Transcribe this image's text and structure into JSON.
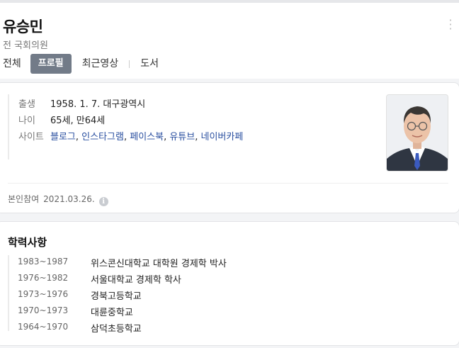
{
  "person": {
    "name": "유승민",
    "subtitle": "전 국회의원"
  },
  "tabs": [
    {
      "label": "전체",
      "active": false
    },
    {
      "label": "프로필",
      "active": true
    },
    {
      "label": "최근영상",
      "active": false
    },
    {
      "label": "도서",
      "active": false
    }
  ],
  "profile": {
    "rows": [
      {
        "label": "출생",
        "value": "1958. 1. 7. 대구광역시"
      },
      {
        "label": "나이",
        "value": "65세, 만64세"
      }
    ],
    "sites_label": "사이트",
    "sites": [
      "블로그",
      "인스타그램",
      "페이스북",
      "유튜브",
      "네이버카페"
    ],
    "verified_label": "본인참여",
    "verified_date": "2021.03.26."
  },
  "education": {
    "title": "학력사항",
    "items": [
      {
        "years": "1983~1987",
        "school": "위스콘신대학교 대학원 경제학 박사"
      },
      {
        "years": "1976~1982",
        "school": "서울대학교 경제학 학사"
      },
      {
        "years": "1973~1976",
        "school": "경북고등학교"
      },
      {
        "years": "1970~1973",
        "school": "대륜중학교"
      },
      {
        "years": "1964~1970",
        "school": "삼덕초등학교"
      }
    ]
  },
  "colors": {
    "active_tab_bg": "#727b88",
    "link": "#2a4fa0",
    "page_bg": "#f3f4f6"
  },
  "icons": {
    "more": "more-vertical-icon",
    "info": "info-circle-icon"
  }
}
